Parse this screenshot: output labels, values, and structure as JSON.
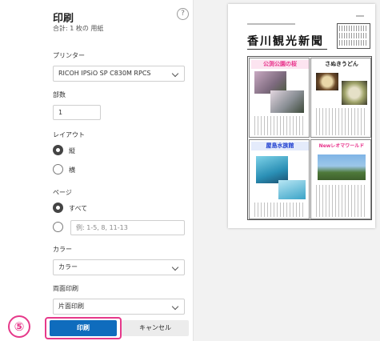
{
  "dialog": {
    "title": "印刷",
    "summary": "合計: 1 枚の 用紙",
    "help_icon": "?"
  },
  "printer": {
    "label": "プリンター",
    "value": "RICOH IPSiO SP C830M RPCS"
  },
  "copies": {
    "label": "部数",
    "value": "1"
  },
  "layout": {
    "label": "レイアウト",
    "options": [
      "縦",
      "横"
    ],
    "selected": "縦"
  },
  "pages": {
    "label": "ページ",
    "options": [
      "すべて"
    ],
    "selected": "すべて",
    "range_placeholder": "例: 1-5, 8, 11-13"
  },
  "color": {
    "label": "カラー",
    "value": "カラー"
  },
  "duplex": {
    "label": "両面印刷",
    "value": "片面印刷"
  },
  "buttons": {
    "print": "印刷",
    "cancel": "キャンセル"
  },
  "annotation": {
    "step": "⑤",
    "color": "#e6398a"
  },
  "preview": {
    "newspaper_title": "香川観光新聞",
    "articles": [
      {
        "heading": "公渕公園の桜",
        "color": "#e8318a"
      },
      {
        "heading": "さぬきうどん",
        "color": "#222222"
      },
      {
        "heading": "屋島水族館",
        "color": "#1f3fd0"
      },
      {
        "heading": "Newレオマワールド",
        "color": "#e8318a"
      }
    ]
  },
  "colors": {
    "accent": "#0f6cbd",
    "highlight": "#e6398a"
  }
}
